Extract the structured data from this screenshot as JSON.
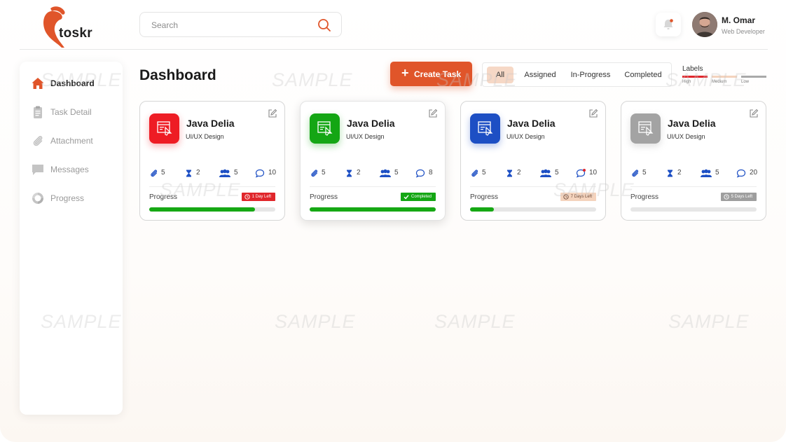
{
  "app": {
    "logo_text": "toskr",
    "brand_color": "#e0552a"
  },
  "search": {
    "placeholder": "Search",
    "value": ""
  },
  "user": {
    "name": "M. Omar",
    "role": "Web Developer"
  },
  "sidebar": {
    "items": [
      {
        "label": "Dashboard",
        "icon": "home-icon",
        "active": true
      },
      {
        "label": "Task Detail",
        "icon": "clipboard-icon",
        "active": false
      },
      {
        "label": "Attachment",
        "icon": "paperclip-icon",
        "active": false
      },
      {
        "label": "Messages",
        "icon": "chat-icon",
        "active": false
      },
      {
        "label": "Progress",
        "icon": "progress-icon",
        "active": false
      }
    ]
  },
  "main": {
    "title": "Dashboard",
    "create_label": "Create Task",
    "filters": [
      {
        "label": "All",
        "active": true
      },
      {
        "label": "Assigned",
        "active": false
      },
      {
        "label": "In-Progress",
        "active": false
      },
      {
        "label": "Completed",
        "active": false
      }
    ],
    "labels": {
      "title": "Labels",
      "items": [
        {
          "name": "High",
          "color": "#e0262b"
        },
        {
          "name": "Medium",
          "color": "#f4d3bd"
        },
        {
          "name": "Low",
          "color": "#a9a9a9"
        }
      ]
    }
  },
  "cards": [
    {
      "title": "Java Delia",
      "subtitle": "UI/UX Design",
      "icon_color": "#ee1c24",
      "attachments": "5",
      "time": "2",
      "members": "5",
      "comments": "10",
      "progress_label": "Progress",
      "badge": "1 Day Left",
      "badge_color": "#e0262b",
      "progress": 0.84,
      "elevated": false
    },
    {
      "title": "Java Delia",
      "subtitle": "UI/UX Design",
      "icon_color": "#14a614",
      "attachments": "5",
      "time": "2",
      "members": "5",
      "comments": "8",
      "progress_label": "Progress",
      "badge": "Completed",
      "badge_color": "#14a614",
      "progress": 1.0,
      "elevated": true
    },
    {
      "title": "Java Delia",
      "subtitle": "UI/UX Design",
      "icon_color": "#1d4fc4",
      "attachments": "5",
      "time": "2",
      "members": "5",
      "comments": "10",
      "progress_label": "Progress",
      "badge": "7 Days Left",
      "badge_color": "#f4d3bd",
      "progress": 0.19,
      "elevated": false
    },
    {
      "title": "Java Delia",
      "subtitle": "UI/UX Design",
      "icon_color": "#a3a3a3",
      "attachments": "5",
      "time": "2",
      "members": "5",
      "comments": "20",
      "progress_label": "Progress",
      "badge": "5 Days Left",
      "badge_color": "#9e9e9e",
      "progress": 0.0,
      "elevated": false
    }
  ],
  "watermark": "SAMPLE"
}
